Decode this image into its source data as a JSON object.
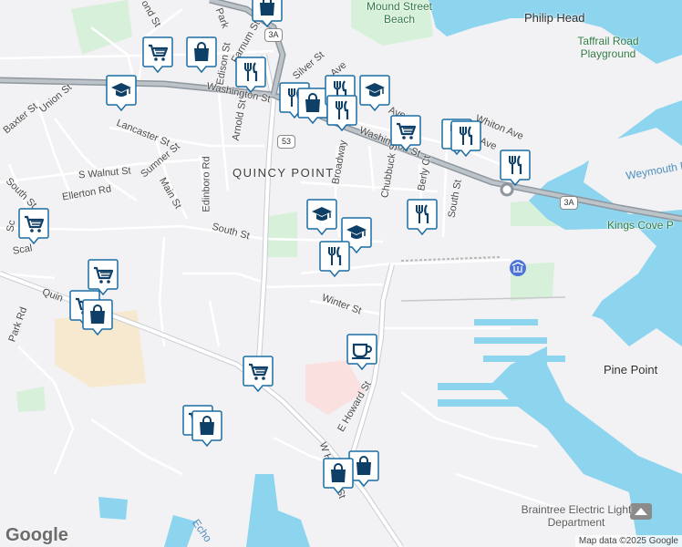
{
  "map": {
    "provider": "Google",
    "attribution": "Map data ©2025 Google",
    "colors": {
      "land": "#f2f1f4",
      "water": "#8dd4ee",
      "park": "#d7f0d9",
      "hospital": "#fbe0e0",
      "campus": "#f6e9cf",
      "road": "#ffffff",
      "highway": "#9aa3ab",
      "pin_border": "#1a6da3",
      "pin_icon": "#0e3f66"
    },
    "labels": {
      "area": "QUINCY POINT",
      "places": [
        "Philip Head",
        "Pine Point"
      ],
      "parks": [
        "Mound Street Beach",
        "Taffrail Road Playground",
        "Kings Cove P"
      ],
      "water": [
        "Weymouth F",
        "Echo"
      ],
      "poi": [
        "Braintree Electric Light Department"
      ],
      "streets": [
        "Pond St",
        "Park",
        "Farnum St",
        "Edison St",
        "Silver St",
        "Ave",
        "Union St",
        "Baxter St",
        "Washington St",
        "Washington St",
        "Lancaster St",
        "Sumner St",
        "Arnold St",
        "Edinboro Rd",
        "S Walnut St",
        "Main St",
        "Ellerton Rd",
        "South St",
        "South St",
        "Broadway",
        "Chubbuck St",
        "Berly Ct",
        "South St",
        "Ave",
        "Ave",
        "Whiton Ave",
        "Scal",
        "Sc",
        "Quin",
        "Park Rd",
        "Winter St",
        "E Howard St",
        "W Howard St"
      ]
    },
    "shields": [
      "3A",
      "53",
      "3A"
    ],
    "pins": [
      {
        "icon": "shopping-cart-icon"
      },
      {
        "icon": "shopping-bag-icon"
      },
      {
        "icon": "restaurant-icon"
      },
      {
        "icon": "school-icon"
      },
      {
        "icon": "restaurant-icon"
      },
      {
        "icon": "shopping-bag-icon"
      },
      {
        "icon": "restaurant-icon"
      },
      {
        "icon": "school-icon"
      },
      {
        "icon": "restaurant-icon"
      },
      {
        "icon": "shopping-cart-icon"
      },
      {
        "icon": "restaurant-icon"
      },
      {
        "icon": "restaurant-icon"
      },
      {
        "icon": "restaurant-icon"
      },
      {
        "icon": "shopping-cart-icon"
      },
      {
        "icon": "school-icon"
      },
      {
        "icon": "restaurant-icon"
      },
      {
        "icon": "school-icon"
      },
      {
        "icon": "restaurant-icon"
      },
      {
        "icon": "shopping-cart-icon"
      },
      {
        "icon": "shopping-cart-icon"
      },
      {
        "icon": "shopping-bag-icon"
      },
      {
        "icon": "coffee-cup-icon"
      },
      {
        "icon": "shopping-cart-icon"
      },
      {
        "icon": "shopping-cart-icon"
      },
      {
        "icon": "shopping-bag-icon"
      },
      {
        "icon": "shopping-bag-icon"
      },
      {
        "icon": "shopping-bag-icon"
      },
      {
        "icon": "shopping-bag-icon"
      }
    ]
  }
}
